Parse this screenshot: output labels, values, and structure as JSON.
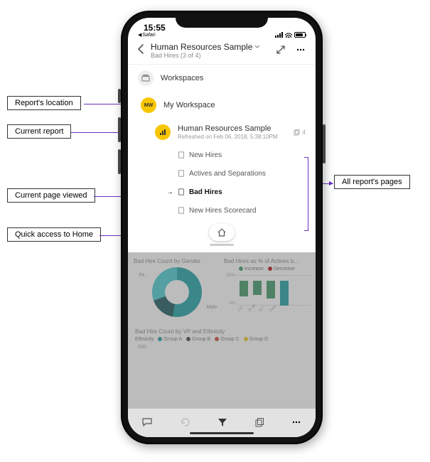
{
  "statusbar": {
    "time": "15:55",
    "back_app": "Safari"
  },
  "header": {
    "title": "Human Resources Sample",
    "subtitle": "Bad Hires (3 of 4)"
  },
  "nav": {
    "workspaces_label": "Workspaces",
    "my_workspace_label": "My Workspace",
    "my_workspace_badge": "MW",
    "report": {
      "title": "Human Resources Sample",
      "sub": "Refreshed on Feb 06, 2018, 5:38:10PM",
      "badge_count": "4"
    },
    "pages": [
      {
        "label": "New Hires",
        "current": false
      },
      {
        "label": "Actives and Separations",
        "current": false
      },
      {
        "label": "Bad Hires",
        "current": true
      },
      {
        "label": "New Hires Scorecard",
        "current": false
      }
    ]
  },
  "report": {
    "chart1_title": "Bad Hire Count by Gender",
    "chart1_labels": {
      "left": "Fe...",
      "right": "Male"
    },
    "chart2_title": "Bad Hires as % of Actives b...",
    "chart2_legend": {
      "a": "Increase",
      "b": "Decrease"
    },
    "chart2_y": {
      "top": "50%",
      "bottom": "0%"
    },
    "chart2_x": [
      "<30",
      "30-49",
      "50+",
      "Total"
    ],
    "chart3_title": "Bad Hire Count by VP and Ethnicity",
    "chart3_label": "Ethnicity",
    "chart3_groups": [
      "Group A",
      "Group B",
      "Group C",
      "Group D"
    ],
    "chart3_y": "500"
  },
  "callouts": {
    "location": "Report's location",
    "current_report": "Current report",
    "current_page": "Current page viewed",
    "home": "Quick access to Home",
    "all_pages": "All report's pages"
  },
  "chart_data": [
    {
      "type": "pie",
      "title": "Bad Hire Count by Gender",
      "categories": [
        "Female",
        "Male"
      ],
      "values": [
        55,
        45
      ]
    },
    {
      "type": "bar",
      "title": "Bad Hires as % of Actives by Age Group",
      "categories": [
        "<30",
        "30-49",
        "50+",
        "Total"
      ],
      "series": [
        {
          "name": "Increase",
          "values": [
            30,
            25,
            30,
            50
          ]
        },
        {
          "name": "Decrease",
          "values": [
            0,
            -5,
            0,
            0
          ]
        }
      ],
      "ylabel": "%",
      "ylim": [
        0,
        50
      ]
    },
    {
      "type": "bar",
      "title": "Bad Hire Count by VP and Ethnicity",
      "legend": [
        "Group A",
        "Group B",
        "Group C",
        "Group D"
      ],
      "ylim": [
        0,
        500
      ]
    }
  ]
}
